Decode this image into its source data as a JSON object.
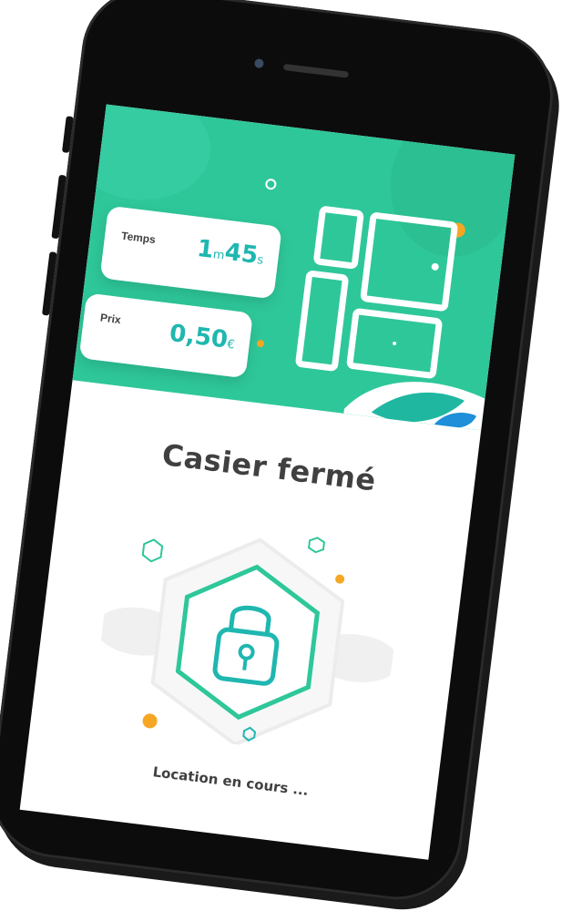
{
  "rental": {
    "time_label": "Temps",
    "time_minutes": "1",
    "time_minutes_unit": "m",
    "time_seconds": "45",
    "time_seconds_unit": "s",
    "price_label": "Prix",
    "price_value": "0,50",
    "price_currency": "€"
  },
  "main": {
    "title": "Casier fermé",
    "status": "Location en cours ..."
  },
  "colors": {
    "primary_green": "#2ec79a",
    "accent_teal": "#1fb7b0",
    "accent_orange": "#f5a623",
    "text_dark": "#404040"
  },
  "icons": {
    "hero": "locker-grid-icon",
    "lock": "padlock-icon"
  }
}
